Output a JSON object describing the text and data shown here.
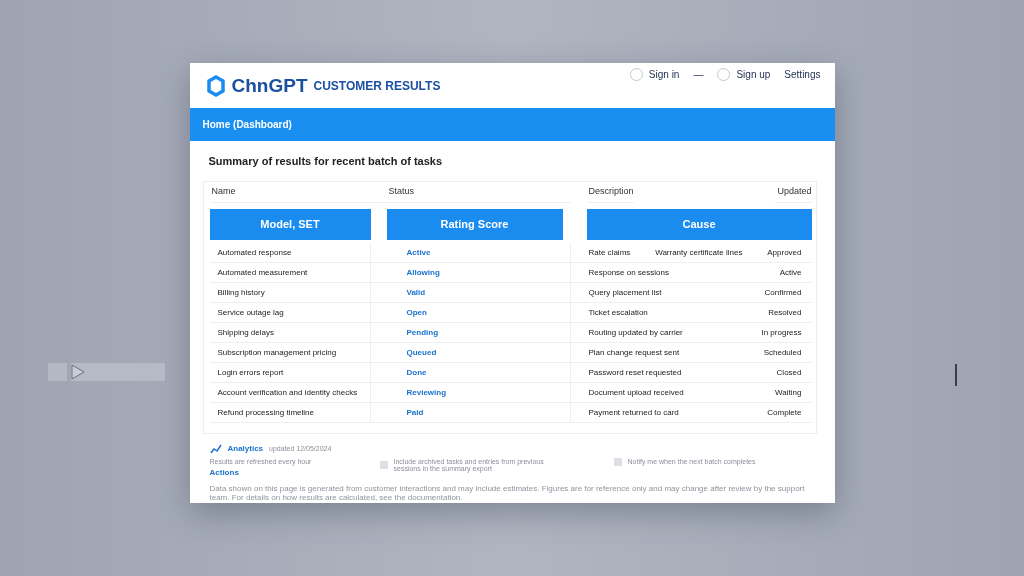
{
  "logo": {
    "name": "ChnGPT",
    "subtitle": "CUSTOMER RESULTS"
  },
  "header_links": [
    {
      "label": "Sign in",
      "kind": "radio",
      "selected": false
    },
    {
      "label": "—",
      "kind": "plain"
    },
    {
      "label": "Sign up",
      "kind": "radio",
      "selected": false
    },
    {
      "label": "Settings",
      "kind": "plain"
    }
  ],
  "breadcrumb": "Home (Dashboard)",
  "heading": "Summary of results for recent batch of tasks",
  "column_labels": [
    "Name",
    "Status",
    "Description",
    "Updated"
  ],
  "tabs": [
    {
      "label": "Model, SET"
    },
    {
      "label": "Rating Score"
    },
    {
      "label": "Cause"
    }
  ],
  "rows": [
    {
      "name": "Automated response",
      "status": "Active",
      "detail": "Rate claims",
      "extra": "Warranty certificate lines",
      "value": "Approved"
    },
    {
      "name": "Automated measurement",
      "status": "Allowing",
      "detail": "Response on sessions",
      "value": "Active"
    },
    {
      "name": "Billing history",
      "status": "Valid",
      "detail": "Query placement list",
      "value": "Confirmed"
    },
    {
      "name": "Service outage lag",
      "status": "Open",
      "detail": "Ticket escalation",
      "value": "Resolved"
    },
    {
      "name": "Shipping delays",
      "status": "Pending",
      "detail": "Routing updated by carrier",
      "value": "In progress"
    },
    {
      "name": "Subscription management pricing",
      "status": "Queued",
      "detail": "Plan change request sent",
      "value": "Scheduled"
    },
    {
      "name": "Login errors report",
      "status": "Done",
      "detail": "Password reset requested",
      "value": "Closed"
    },
    {
      "name": "Account verification and identity checks",
      "status": "Reviewing",
      "detail": "Document upload received",
      "value": "Waiting"
    },
    {
      "name": "Refund processing timeline",
      "status": "Paid",
      "detail": "Payment returned to card",
      "value": "Complete"
    }
  ],
  "footer": {
    "link": "Analytics",
    "link_note": "updated 12/05/2024",
    "note": "Results are refreshed every hour",
    "link2": "Actions",
    "checks": [
      {
        "label": "Include archived tasks and entries from previous sessions in the summary export",
        "checked": false
      },
      {
        "label": "Notify me when the next batch completes",
        "checked": false
      }
    ],
    "paragraph": "Data shown on this page is generated from customer interactions and may include estimates. Figures are for reference only and may change after review by the support team. For details on how results are calculated, see the documentation."
  }
}
